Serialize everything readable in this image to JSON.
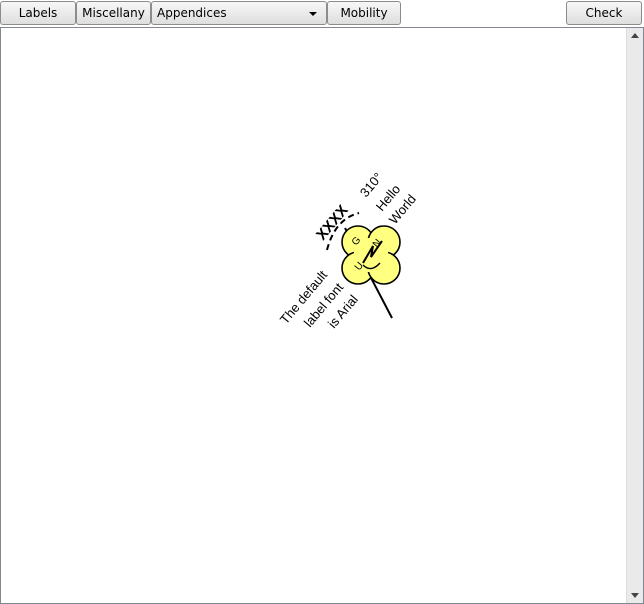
{
  "toolbar": {
    "labels_button": "Labels",
    "miscellany_button": "Miscellany",
    "appendices_combo": {
      "selected": "Appendices"
    },
    "mobility_button": "Mobility",
    "check_button": "Check"
  },
  "symbol": {
    "fill_color": "#ffff80",
    "heading_label": "310°",
    "hello_label": "Hello",
    "world_label": "World",
    "xxxx_label": "XXXX",
    "default_font_line1": "The default",
    "default_font_line2": "label font",
    "default_font_line3": "is Arial",
    "letter_g": "G",
    "letter_u": "U",
    "letter_n": "N"
  }
}
